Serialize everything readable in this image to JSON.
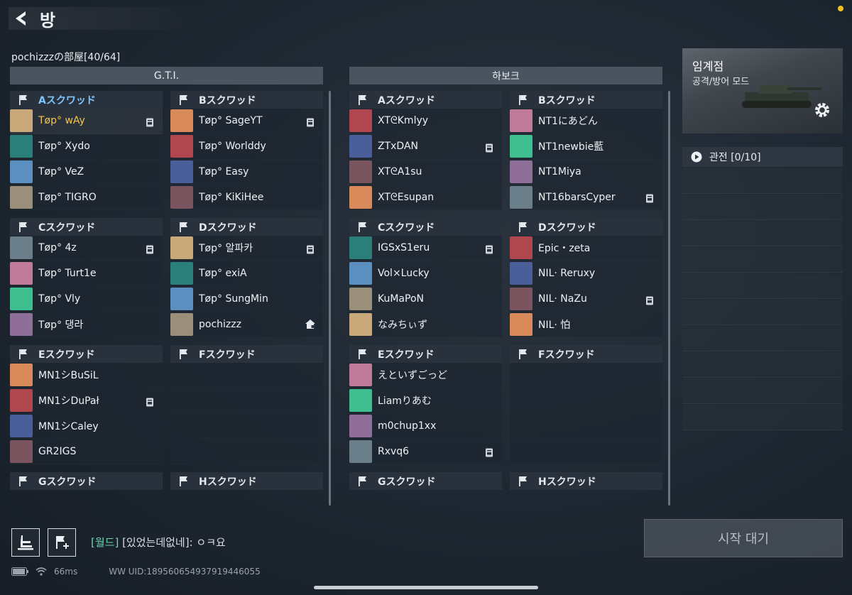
{
  "header": {
    "title": "방"
  },
  "room": {
    "name": "pochizzzの部屋[40/64]"
  },
  "teams": [
    {
      "name": "G.T.I.",
      "squads": [
        {
          "name": "Aスクワッド",
          "active": true,
          "players": [
            {
              "name": "Tøp° wAy",
              "me": true,
              "badge": true
            },
            {
              "name": "Tøp° Xydo"
            },
            {
              "name": "Tøp° VeZ"
            },
            {
              "name": "Tøp° TIGRO"
            }
          ]
        },
        {
          "name": "Bスクワッド",
          "players": [
            {
              "name": "Tøp° SageYT",
              "badge": true
            },
            {
              "name": "Tøp° Worlddy"
            },
            {
              "name": "Tøp° Easy"
            },
            {
              "name": "Tøp° KiKiHee"
            }
          ]
        },
        {
          "name": "Cスクワッド",
          "players": [
            {
              "name": "Tøp° 4z",
              "badge": true
            },
            {
              "name": "Tøp° Turt1e"
            },
            {
              "name": "Tøp° Vly"
            },
            {
              "name": "Tøp° 댕라"
            }
          ]
        },
        {
          "name": "Dスクワッド",
          "players": [
            {
              "name": "Tøp° 알파카",
              "badge": true
            },
            {
              "name": "Tøp° exiA"
            },
            {
              "name": "Tøp° SungMin"
            },
            {
              "name": "pochizzz",
              "host": true
            }
          ]
        },
        {
          "name": "Eスクワッド",
          "players": [
            {
              "name": "MN1シBuSiL"
            },
            {
              "name": "MN1シDuPał",
              "badge": true
            },
            {
              "name": "MN1シCaley"
            },
            {
              "name": "GR2IGS"
            }
          ]
        },
        {
          "name": "Fスクワッド",
          "players": [
            {},
            {},
            {},
            {}
          ]
        },
        {
          "name": "Gスクワッド",
          "players": []
        },
        {
          "name": "Hスクワッド",
          "players": []
        }
      ]
    },
    {
      "name": "하보크",
      "squads": [
        {
          "name": "Aスクワッド",
          "players": [
            {
              "name": "XTᘓKmlyy"
            },
            {
              "name": "ZTxDAN",
              "badge": true
            },
            {
              "name": "XTᘓA1su"
            },
            {
              "name": "XTᘓEsupan"
            }
          ]
        },
        {
          "name": "Bスクワッド",
          "players": [
            {
              "name": "NT1にあどん"
            },
            {
              "name": "NT1newbie藍"
            },
            {
              "name": "NT1Miya"
            },
            {
              "name": "NT16barsCyper",
              "badge": true
            }
          ]
        },
        {
          "name": "Cスクワッド",
          "players": [
            {
              "name": "IGSxS1eru",
              "badge": true
            },
            {
              "name": "Vol×Lucky"
            },
            {
              "name": "KuMaPoN"
            },
            {
              "name": "なみちぃず"
            }
          ]
        },
        {
          "name": "Dスクワッド",
          "players": [
            {
              "name": "Epic・zeta"
            },
            {
              "name": "NIL· Reruxy"
            },
            {
              "name": "NIL· NaZu",
              "badge": true
            },
            {
              "name": "NIL· 怕"
            }
          ]
        },
        {
          "name": "Eスクワッド",
          "players": [
            {
              "name": "えといずごっど"
            },
            {
              "name": "Liamりあむ"
            },
            {
              "name": "m0chup1xx"
            },
            {
              "name": "Rxvq6",
              "badge": true
            }
          ]
        },
        {
          "name": "Fスクワッド",
          "players": [
            {},
            {},
            {},
            {}
          ]
        },
        {
          "name": "Gスクワッド",
          "players": []
        },
        {
          "name": "Hスクワッド",
          "players": []
        }
      ]
    }
  ],
  "mode": {
    "title": "임계점",
    "subtitle": "공격/방어 모드"
  },
  "spectate": {
    "label": "관전 [0/10]"
  },
  "chat": {
    "channel": "[월드]",
    "message": " [있었는데없네]: ㅇㅋ요"
  },
  "start_button": {
    "label": "시작 대기"
  },
  "status": {
    "ping": "66ms",
    "uid": "WW UID:1895606549379194460​55"
  },
  "colors": {
    "accent_blue": "#7fc6ff",
    "me_yellow": "#f1c453",
    "chat_green": "#6dd8b0"
  }
}
